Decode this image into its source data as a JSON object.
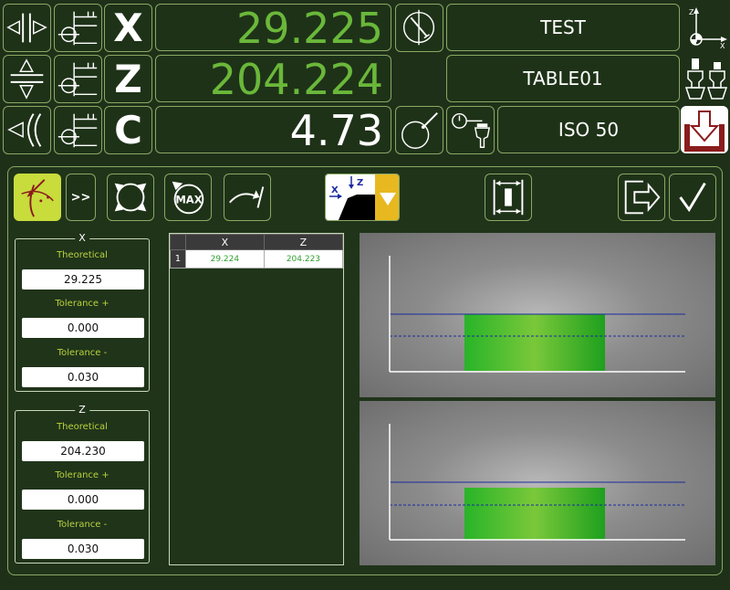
{
  "readouts": {
    "x": {
      "axis": "X",
      "value": "29.225",
      "color": "#6ab83a"
    },
    "z": {
      "axis": "Z",
      "value": "204.224",
      "color": "#6ab83a"
    },
    "c": {
      "axis": "C",
      "value": "4.73",
      "color": "#ffffff"
    }
  },
  "info": {
    "program": "TEST",
    "table": "TABLE01",
    "tool_holder": "ISO 50"
  },
  "icons": {
    "row1": [
      "horizontal-mirror-icon",
      "origin-offset-icon"
    ],
    "row2": [
      "vertical-mirror-icon",
      "origin-offset-icon"
    ],
    "row3": [
      "rotary-axis-icon",
      "origin-offset-icon"
    ],
    "measure": "measure-gauge-icon",
    "probe": "probe-ball-icon",
    "tool_probe": "tool-probe-icon",
    "axes": "axis-orientation-icon",
    "tool_change": "tool-change-icon",
    "unload": "unload-tool-icon"
  },
  "toolbar": {
    "next_label": ">>",
    "max_label": "MAX",
    "dropdown_axes": [
      "X",
      "Z"
    ]
  },
  "tolerances": {
    "x": {
      "legend": "X",
      "theoretical_label": "Theoretical",
      "theoretical": "29.225",
      "tol_plus_label": "Tolerance +",
      "tol_plus": "0.000",
      "tol_minus_label": "Tolerance -",
      "tol_minus": "0.030"
    },
    "z": {
      "legend": "Z",
      "theoretical_label": "Theoretical",
      "theoretical": "204.230",
      "tol_plus_label": "Tolerance +",
      "tol_plus": "0.000",
      "tol_minus_label": "Tolerance -",
      "tol_minus": "0.030"
    }
  },
  "measurements": {
    "columns": [
      "X",
      "Z"
    ],
    "rows": [
      {
        "n": "1",
        "x": "29.224",
        "z": "204.223"
      }
    ]
  },
  "colors": {
    "accent_green": "#6ab83a",
    "active_yellow": "#c8dc3c",
    "border": "#8aa864",
    "bar_green": "#3cc83c",
    "limit_line": "#1a2aa0",
    "unload_red": "#8a1c1c"
  }
}
